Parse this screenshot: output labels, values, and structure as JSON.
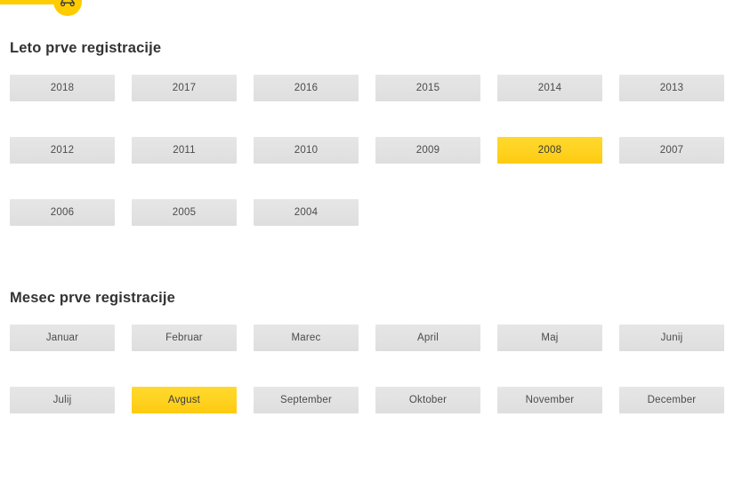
{
  "stepper": {
    "icon": "car-icon",
    "accent_color": "#ffcc00",
    "track_color": "#ececec"
  },
  "sections": [
    {
      "id": "year-of-first-registration",
      "title": "Leto prve registracije",
      "options": [
        {
          "label": "2018",
          "selected": false
        },
        {
          "label": "2017",
          "selected": false
        },
        {
          "label": "2016",
          "selected": false
        },
        {
          "label": "2015",
          "selected": false
        },
        {
          "label": "2014",
          "selected": false
        },
        {
          "label": "2013",
          "selected": false
        },
        {
          "label": "2012",
          "selected": false
        },
        {
          "label": "2011",
          "selected": false
        },
        {
          "label": "2010",
          "selected": false
        },
        {
          "label": "2009",
          "selected": false
        },
        {
          "label": "2008",
          "selected": true
        },
        {
          "label": "2007",
          "selected": false
        },
        {
          "label": "2006",
          "selected": false
        },
        {
          "label": "2005",
          "selected": false
        },
        {
          "label": "2004",
          "selected": false
        }
      ]
    },
    {
      "id": "month-of-first-registration",
      "title": "Mesec prve registracije",
      "options": [
        {
          "label": "Januar",
          "selected": false
        },
        {
          "label": "Februar",
          "selected": false
        },
        {
          "label": "Marec",
          "selected": false
        },
        {
          "label": "April",
          "selected": false
        },
        {
          "label": "Maj",
          "selected": false
        },
        {
          "label": "Junij",
          "selected": false
        },
        {
          "label": "Julij",
          "selected": false
        },
        {
          "label": "Avgust",
          "selected": true
        },
        {
          "label": "September",
          "selected": false
        },
        {
          "label": "Oktober",
          "selected": false
        },
        {
          "label": "November",
          "selected": false
        },
        {
          "label": "December",
          "selected": false
        }
      ]
    }
  ],
  "colors": {
    "accent": "#ffcc00",
    "selected_button": "#ffd21f",
    "button": "#e2e2e2",
    "text": "#4b4b4b",
    "heading": "#333333"
  }
}
